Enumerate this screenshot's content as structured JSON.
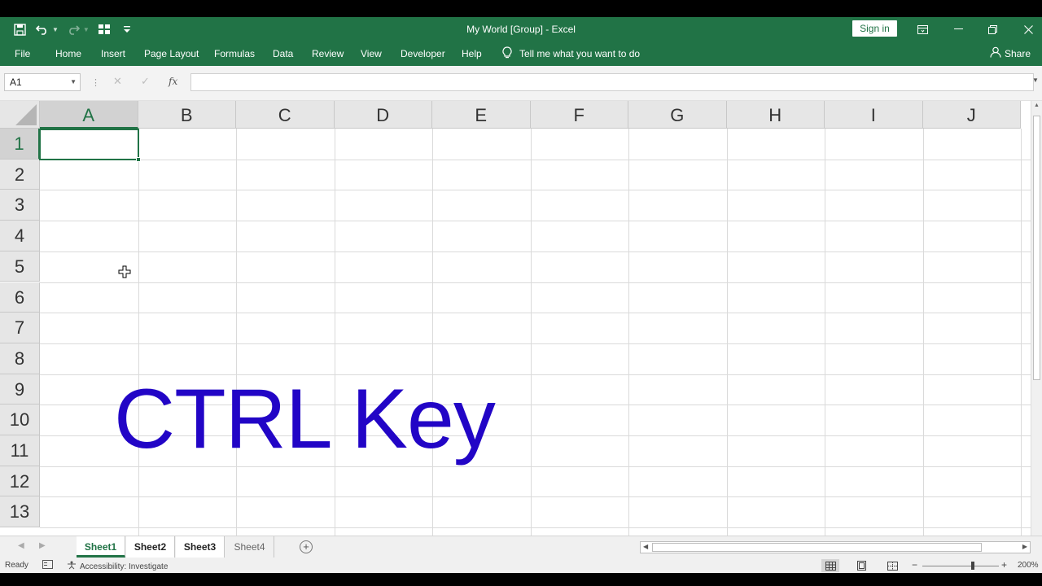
{
  "window": {
    "title": "My World  [Group]  -  Excel",
    "sign_in_label": "Sign in"
  },
  "ribbon": {
    "tabs": [
      "File",
      "Home",
      "Insert",
      "Page Layout",
      "Formulas",
      "Data",
      "Review",
      "View",
      "Developer",
      "Help"
    ],
    "tell_me": "Tell me what you want to do",
    "share": "Share"
  },
  "formula_bar": {
    "name_box": "A1",
    "fx": "fx",
    "value": ""
  },
  "grid": {
    "columns": [
      "A",
      "B",
      "C",
      "D",
      "E",
      "F",
      "G",
      "H",
      "I",
      "J"
    ],
    "rows": [
      "1",
      "2",
      "3",
      "4",
      "5",
      "6",
      "7",
      "8",
      "9",
      "10",
      "11",
      "12",
      "13"
    ],
    "selected_cell": "A1",
    "overlay_text": "CTRL Key",
    "overlay_color": "#2205c6"
  },
  "sheets": [
    {
      "name": "Sheet1",
      "state": "active"
    },
    {
      "name": "Sheet2",
      "state": "grouped"
    },
    {
      "name": "Sheet3",
      "state": "grouped"
    },
    {
      "name": "Sheet4",
      "state": "normal"
    }
  ],
  "status_bar": {
    "status": "Ready",
    "accessibility": "Accessibility: Investigate",
    "zoom": "200%"
  },
  "colors": {
    "accent": "#217346"
  }
}
